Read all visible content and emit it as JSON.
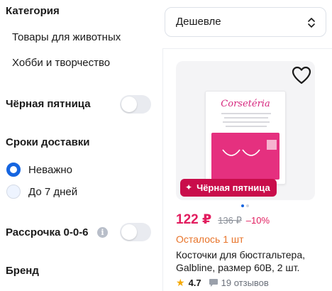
{
  "sidebar": {
    "category_title": "Категория",
    "categories": [
      "Товары для животных",
      "Хобби и творчество"
    ],
    "black_friday_label": "Чёрная пятница",
    "black_friday_enabled": false,
    "delivery_title": "Сроки доставки",
    "delivery_options": [
      {
        "label": "Неважно",
        "selected": true
      },
      {
        "label": "До 7 дней",
        "selected": false
      }
    ],
    "installment_label": "Рассрочка 0-0-6",
    "installment_enabled": false,
    "brand_title": "Бренд"
  },
  "sort": {
    "value": "Дешевле"
  },
  "product": {
    "package_brand": "Corsetéria",
    "badge_label": "Чёрная пятница",
    "price": "122 ₽",
    "old_price": "136 ₽",
    "discount": "–10%",
    "stock": "Осталось 1 шт",
    "name": "Косточки для бюстгальтера, Galbline, размер 60B, 2 шт.",
    "rating": "4.7",
    "reviews": "19 отзывов",
    "image_count": 2,
    "active_image": 1
  },
  "colors": {
    "accent_blue": "#1565e0",
    "price_pink": "#e21d5f",
    "badge_red": "#c90d4b",
    "stock_orange": "#e8742a",
    "star_yellow": "#f5a800"
  },
  "icons": {
    "favorite": "heart-icon",
    "sort": "sort-chevron-icon",
    "info": "info-icon",
    "rating": "star-icon",
    "reviews": "comment-icon",
    "badge": "sparkle-icon"
  }
}
